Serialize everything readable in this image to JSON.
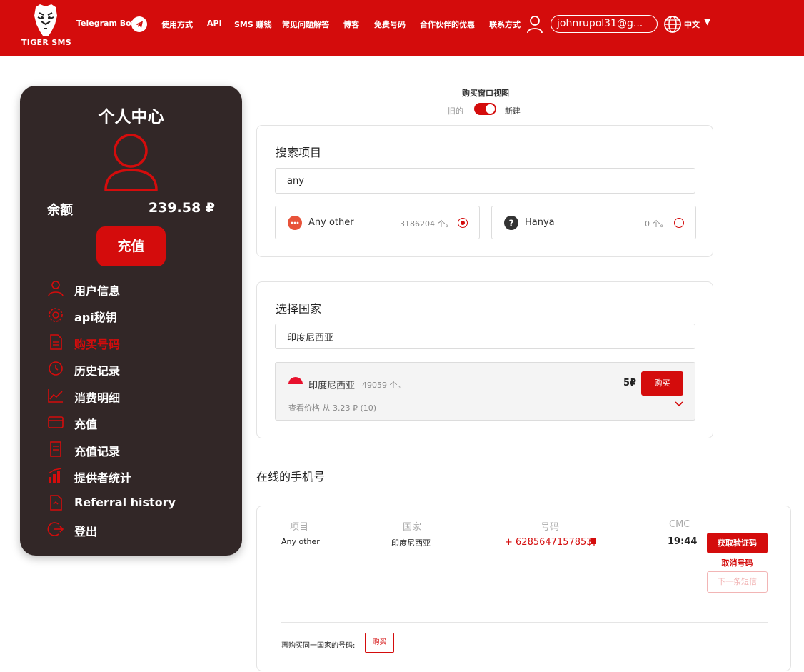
{
  "header": {
    "logo_text": "TIGER SMS",
    "nav": {
      "telegram": "Telegram Bot",
      "how_to": "使用方式",
      "api": "API",
      "earn": "SMS 赚钱",
      "faq": "常见问题解答",
      "blog": "博客",
      "free": "免费号码",
      "partners": "合作伙伴的优惠",
      "contacts": "联系方式"
    },
    "email": "johnrupol31@g...",
    "language": "中文"
  },
  "sidebar": {
    "title": "个人中心",
    "balance_label": "余额",
    "balance_value": "239.58 ₽",
    "topup_label": "充值",
    "menu": [
      {
        "label": "用户信息",
        "icon": "user-icon"
      },
      {
        "label": "api秘钥",
        "icon": "api-gear-icon"
      },
      {
        "label": "购买号码",
        "icon": "buy-document-icon",
        "active": true
      },
      {
        "label": "历史记录",
        "icon": "history-icon"
      },
      {
        "label": "消费明细",
        "icon": "chart-line-icon"
      },
      {
        "label": "充值",
        "icon": "wallet-icon"
      },
      {
        "label": "充值记录",
        "icon": "receipt-icon"
      },
      {
        "label": "提供者统计",
        "icon": "bar-stats-icon"
      },
      {
        "label": "Referral history",
        "icon": "referral-icon"
      },
      {
        "label": "登出",
        "icon": "logout-icon"
      }
    ]
  },
  "view_toggle": {
    "title": "购买窗口视图",
    "old_label": "旧的",
    "new_label": "新建",
    "state": "new"
  },
  "search_service": {
    "title": "搜索项目",
    "query": "any",
    "results": [
      {
        "name": "Any other",
        "count": "3186204 个。",
        "selected": true,
        "icon": "dots-icon",
        "icon_color": "#e8533a"
      },
      {
        "name": "Hanya",
        "count": "0 个。",
        "selected": false,
        "icon": "question-icon",
        "icon_color": "#333333"
      }
    ]
  },
  "select_country": {
    "title": "选择国家",
    "query": "印度尼西亚",
    "result": {
      "name": "印度尼西亚",
      "count": "49059 个。",
      "price": "5₽",
      "buy_label": "购买",
      "price_from": "查看价格 从 3.23 ₽ (10)"
    }
  },
  "online_numbers": {
    "title": "在线的手机号",
    "columns": [
      "项目",
      "国家",
      "号码",
      "CMC"
    ],
    "row": {
      "service": "Any other",
      "country": "印度尼西亚",
      "phone": "+ 6285647157853",
      "timer": "19:44"
    },
    "get_code_label": "获取验证码",
    "cancel_label": "取消号码",
    "next_sms_label": "下一条短信",
    "rebuy_label": "再购买同一国家的号码:",
    "rebuy_button": "购买"
  },
  "colors": {
    "brand_red": "#d40c0c",
    "sidebar_bg": "#322727"
  }
}
